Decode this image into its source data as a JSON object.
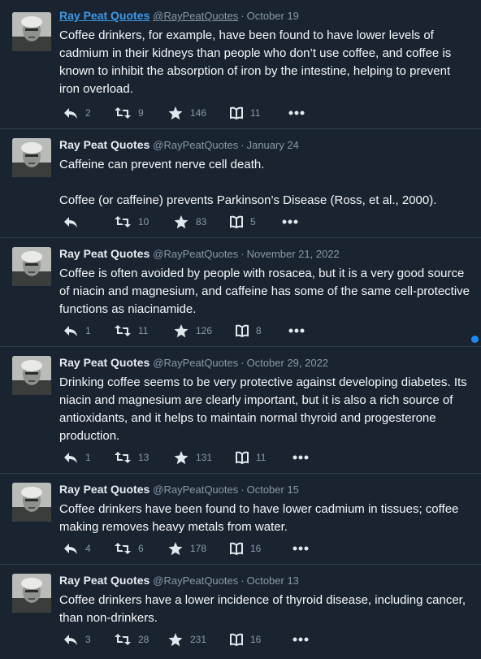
{
  "colors": {
    "background": "#1a2431",
    "accent": "#3b9ae8",
    "muted": "#8899a6"
  },
  "tweets": [
    {
      "name": "Ray Peat Quotes",
      "handle": "@RayPeatQuotes",
      "date": "October 19",
      "text": "Coffee drinkers, for example, have been found to have lower levels of cadmium in their kidneys than people who don’t use coffee, and coffee is known to inhibit the absorption of iron by the intestine, helping to prevent iron overload.",
      "replies": "2",
      "retweets": "9",
      "likes": "146",
      "reads": "11"
    },
    {
      "name": "Ray Peat Quotes",
      "handle": "@RayPeatQuotes",
      "date": "January 24",
      "text": "Caffeine can prevent nerve cell death.\n\nCoffee (or caffeine) prevents Parkinson’s Disease (Ross, et al., 2000).",
      "replies": "",
      "retweets": "10",
      "likes": "83",
      "reads": "5"
    },
    {
      "name": "Ray Peat Quotes",
      "handle": "@RayPeatQuotes",
      "date": "November 21, 2022",
      "text": "Coffee is often avoided by people with rosacea, but it is a very good source of niacin and magnesium, and caffeine has some of the same cell-protective functions as niacinamide.",
      "replies": "1",
      "retweets": "11",
      "likes": "126",
      "reads": "8"
    },
    {
      "name": "Ray Peat Quotes",
      "handle": "@RayPeatQuotes",
      "date": "October 29, 2022",
      "text": "Drinking coffee seems to be very protective against developing diabetes. Its niacin and magnesium are clearly important, but it is also a rich source of antioxidants, and it helps to maintain normal thyroid and progesterone production.",
      "replies": "1",
      "retweets": "13",
      "likes": "131",
      "reads": "11"
    },
    {
      "name": "Ray Peat Quotes",
      "handle": "@RayPeatQuotes",
      "date": "October 15",
      "text": "Coffee drinkers have been found to have lower cadmium in tissues; coffee making removes heavy metals from water.",
      "replies": "4",
      "retweets": "6",
      "likes": "178",
      "reads": "16"
    },
    {
      "name": "Ray Peat Quotes",
      "handle": "@RayPeatQuotes",
      "date": "October 13",
      "text": "Coffee drinkers have a lower incidence of thyroid disease, including cancer, than non-drinkers.",
      "replies": "3",
      "retweets": "28",
      "likes": "231",
      "reads": "16"
    }
  ]
}
